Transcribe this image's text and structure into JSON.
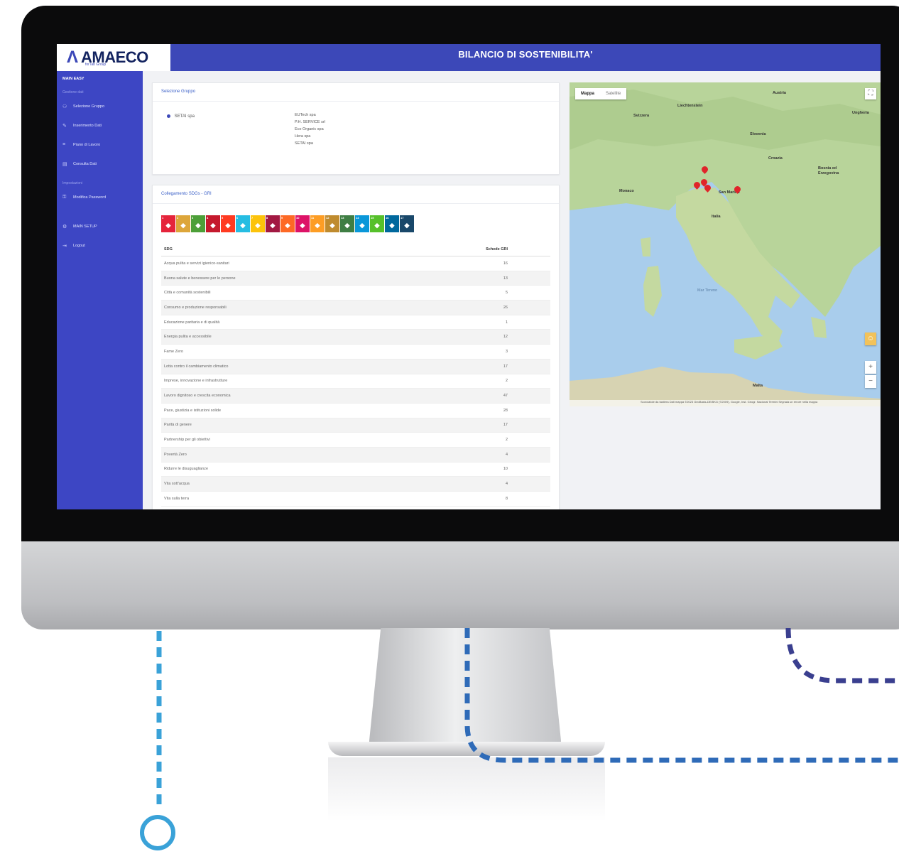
{
  "header": {
    "logo_text": "AMAECO",
    "logo_subtitle": "for lab Group",
    "title": "BILANCIO DI SOSTENIBILITA'"
  },
  "sidebar": {
    "main_label": "MAIN EASY",
    "section1": "Gestione dati",
    "section2": "Impostazioni",
    "items": [
      {
        "label": "Selezione Gruppo",
        "icon": "users-icon"
      },
      {
        "label": "Inserimento Dati",
        "icon": "edit-icon"
      },
      {
        "label": "Piano di Lavoro",
        "icon": "list-icon"
      },
      {
        "label": "Consulta Dati",
        "icon": "chart-icon"
      },
      {
        "label": "Modifica Password",
        "icon": "key-icon"
      },
      {
        "label": "MAIN SETUP",
        "icon": "settings-icon"
      },
      {
        "label": "Logout",
        "icon": "logout-icon"
      }
    ]
  },
  "group_card": {
    "title": "Selezione Gruppo",
    "selected_group": "SETAI spa",
    "companies": [
      "EUTech spa",
      "P.H. SERVICE srl",
      "Eco Organic spa",
      "Hera spa",
      "SETAI spa"
    ]
  },
  "sdg_card": {
    "title": "Collegamento SDGs - GRI",
    "table": {
      "headers": [
        "SDG",
        "Schede GRI"
      ],
      "rows": [
        [
          "Acqua pulita e servizi igienico-sanitari",
          "16"
        ],
        [
          "Buona salute e benessere per le persone",
          "13"
        ],
        [
          "Città e comunità sostenibili",
          "5"
        ],
        [
          "Consumo e produzione responsabili",
          "26"
        ],
        [
          "Educazione paritaria e di qualità",
          "1"
        ],
        [
          "Energia pulita e accessibile",
          "12"
        ],
        [
          "Fame Zero",
          "3"
        ],
        [
          "Lotta contro il cambiamento climatico",
          "17"
        ],
        [
          "Imprese, innovazione e infrastrutture",
          "2"
        ],
        [
          "Lavoro dignitoso e crescita economica",
          "47"
        ],
        [
          "Pace, giustizia e istituzioni solide",
          "28"
        ],
        [
          "Parità di genere",
          "17"
        ],
        [
          "Partnership per gli obiettivi",
          "2"
        ],
        [
          "Povertà Zero",
          "4"
        ],
        [
          "Ridurre le disuguaglianze",
          "10"
        ],
        [
          "Vita sott'acqua",
          "4"
        ],
        [
          "Vita sulla terra",
          "8"
        ]
      ]
    }
  },
  "sdg_icons": [
    {
      "n": "1",
      "color": "#e5243b"
    },
    {
      "n": "2",
      "color": "#dda63a"
    },
    {
      "n": "3",
      "color": "#4c9f38"
    },
    {
      "n": "4",
      "color": "#c5192d"
    },
    {
      "n": "5",
      "color": "#ff3a21"
    },
    {
      "n": "6",
      "color": "#26bde2"
    },
    {
      "n": "7",
      "color": "#fcc30b"
    },
    {
      "n": "8",
      "color": "#a21942"
    },
    {
      "n": "9",
      "color": "#fd6925"
    },
    {
      "n": "10",
      "color": "#dd1367"
    },
    {
      "n": "11",
      "color": "#fd9d24"
    },
    {
      "n": "12",
      "color": "#bf8b2e"
    },
    {
      "n": "13",
      "color": "#3f7e44"
    },
    {
      "n": "14",
      "color": "#0a97d9"
    },
    {
      "n": "15",
      "color": "#56c02b"
    },
    {
      "n": "16",
      "color": "#00689d"
    },
    {
      "n": "17",
      "color": "#19486a"
    }
  ],
  "map": {
    "tabs": [
      "Mappa",
      "Satellite"
    ],
    "labels": {
      "austria": "Austria",
      "ungheria": "Ungheria",
      "liechtenstein": "Liechtenstein",
      "svizzera": "Svizzera",
      "slovenia": "Slovenia",
      "croazia": "Croazia",
      "bosnia": "Bosnia ed Erzegovina",
      "monaco": "Monaco",
      "san_marino": "San Marino",
      "italia": "Italia",
      "tyrrhenian": "Mar Tirreno",
      "malta": "Malta"
    },
    "zoom_in": "+",
    "zoom_out": "−",
    "attribution": "Scorciatoie da tastiera   Dati mappa ©2023 GeoBasis-DE/BKG (©2009), Google, Inst. Geogr. Nacional   Termini   Segnala un errore nella mappa"
  },
  "colors": {
    "brand": "#3c48b8",
    "sidebar": "#3d46c4",
    "pin": "#e0242a"
  }
}
